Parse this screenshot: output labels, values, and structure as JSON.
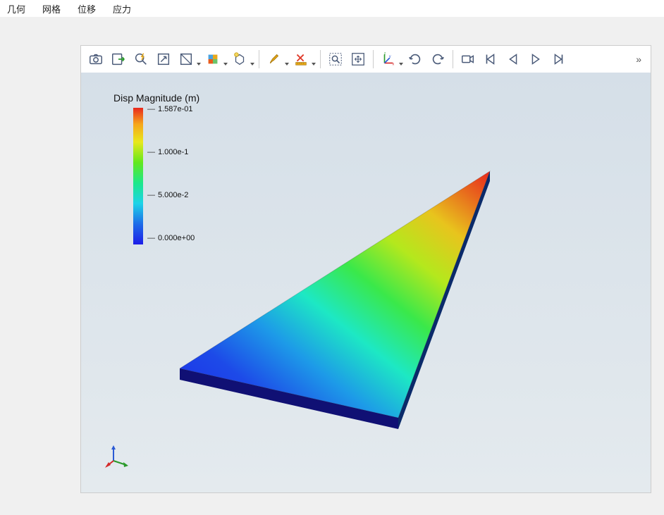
{
  "menu": {
    "items": [
      "几何",
      "网格",
      "位移",
      "应力"
    ]
  },
  "toolbar": {
    "overflow": "»"
  },
  "legend": {
    "title": "Disp Magnitude (m)",
    "ticks": [
      {
        "label": "1.587e-01",
        "pos": 0
      },
      {
        "label": "1.000e-1",
        "pos": 61
      },
      {
        "label": "5.000e-2",
        "pos": 122
      },
      {
        "label": "0.000e+00",
        "pos": 183
      }
    ]
  },
  "triad": {
    "x": "x",
    "y": "y",
    "z": "z"
  },
  "chart_data": {
    "type": "heatmap",
    "title": "Disp Magnitude (m)",
    "colormap": "jet",
    "range": [
      0.0,
      0.1587
    ],
    "ticks": [
      0.0,
      0.05,
      0.1,
      0.1587
    ],
    "units": "m",
    "geometry": "triangular plate",
    "note": "Displacement magnitude field on a thin triangular plate; value increases from 0 at the wide base (blue) to ~0.1587 m at the sharp tip (red)."
  }
}
